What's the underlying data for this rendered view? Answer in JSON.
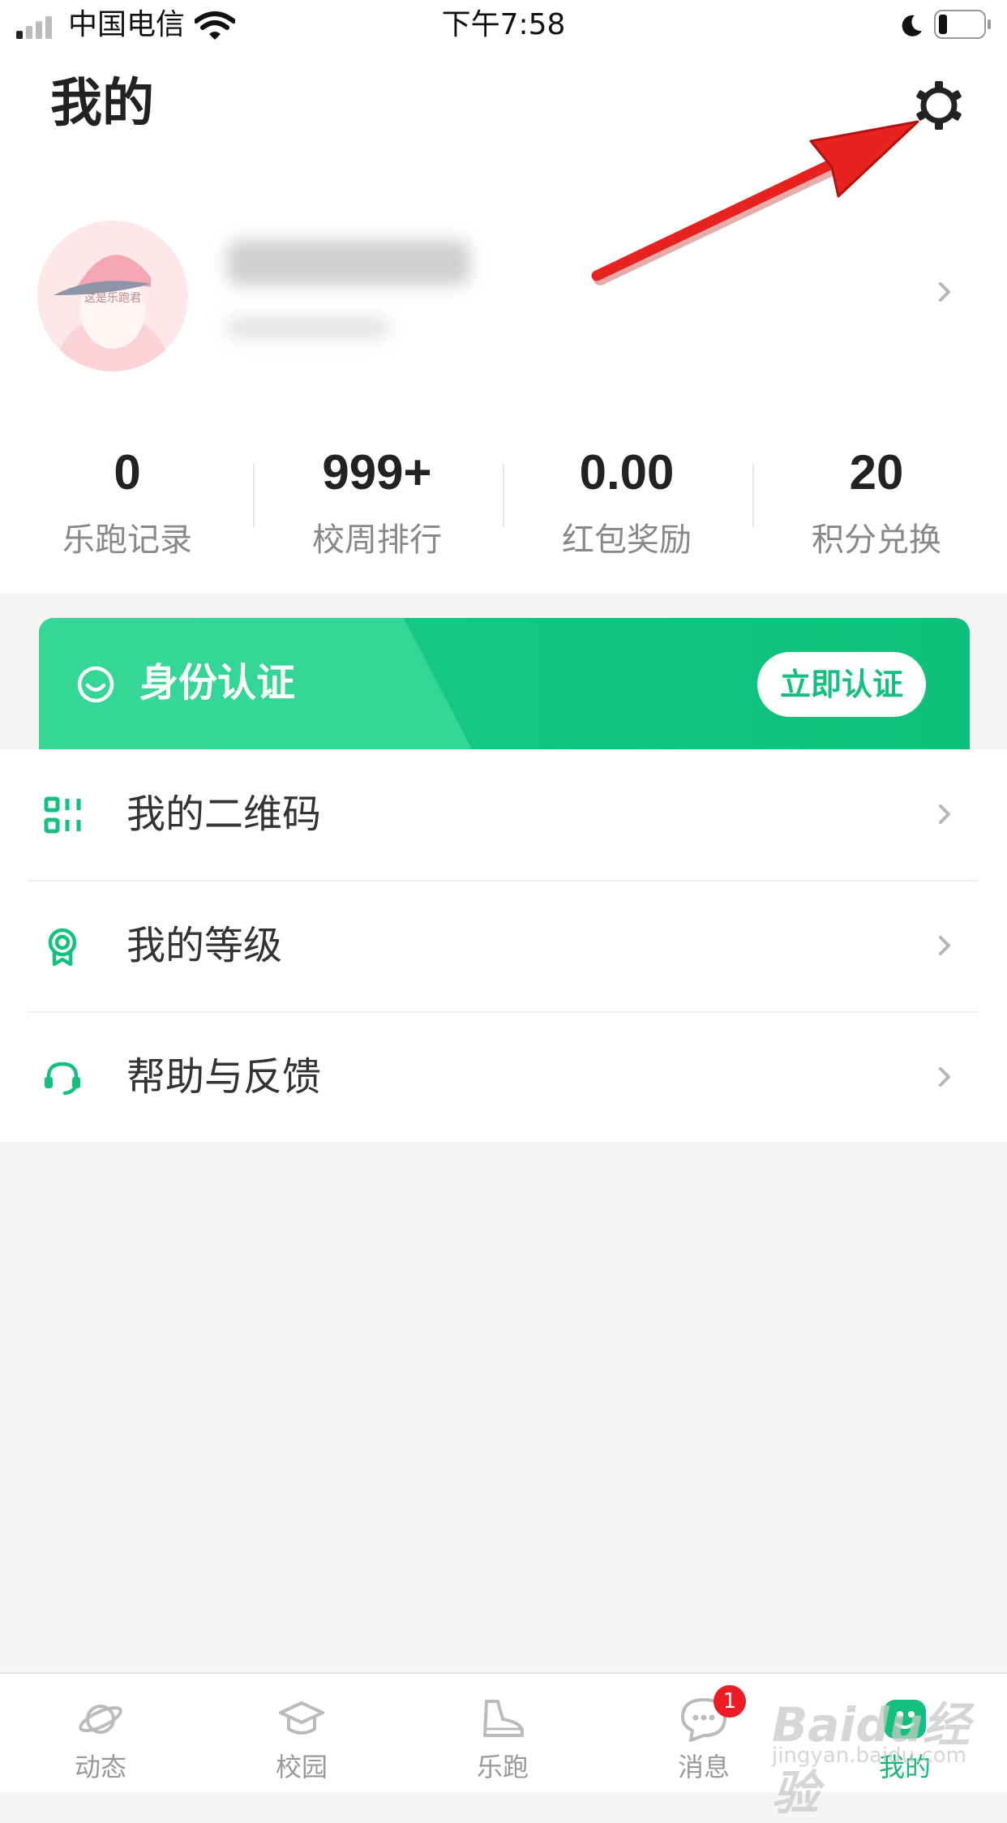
{
  "status_bar": {
    "carrier": "中国电信",
    "time": "下午7:58"
  },
  "page": {
    "title": "我的"
  },
  "stats": [
    {
      "value": "0",
      "label": "乐跑记录"
    },
    {
      "value": "999+",
      "label": "校周排行"
    },
    {
      "value": "0.00",
      "label": "红包奖励"
    },
    {
      "value": "20",
      "label": "积分兑换"
    }
  ],
  "verify_banner": {
    "label": "身份认证",
    "button": "立即认证"
  },
  "menu": [
    {
      "label": "我的二维码",
      "icon": "qr-code-icon"
    },
    {
      "label": "我的等级",
      "icon": "medal-icon"
    },
    {
      "label": "帮助与反馈",
      "icon": "headset-icon"
    }
  ],
  "tabs": [
    {
      "label": "动态",
      "icon": "planet-icon"
    },
    {
      "label": "校园",
      "icon": "graduation-cap-icon"
    },
    {
      "label": "乐跑",
      "icon": "sneaker-icon"
    },
    {
      "label": "消息",
      "icon": "chat-bubble-icon",
      "badge": "1"
    },
    {
      "label": "我的",
      "icon": "profile-icon",
      "active": true
    }
  ],
  "avatar_text": "这是乐跑君",
  "watermark": {
    "main": "Baidu经验",
    "sub": "jingyan.baidu.com"
  },
  "colors": {
    "accent": "#14c07f",
    "badge": "#ee1c25",
    "annotation_arrow": "#e8231f"
  }
}
